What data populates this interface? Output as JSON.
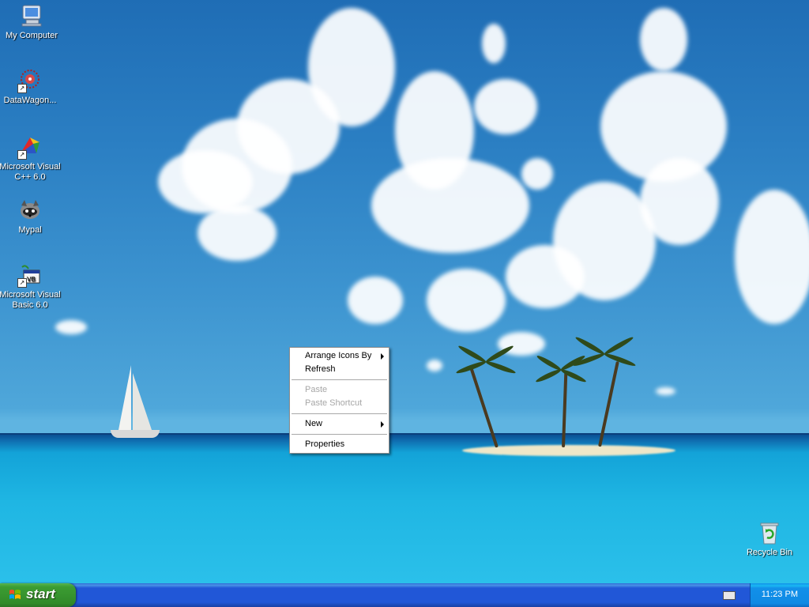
{
  "desktop": {
    "icons": [
      {
        "label": "My Computer",
        "icon": "my-computer-icon"
      },
      {
        "label": "DataWagon...",
        "icon": "datawagon-icon"
      },
      {
        "label": "Microsoft Visual C++ 6.0",
        "icon": "visual-cpp-icon"
      },
      {
        "label": "Mypal",
        "icon": "mypal-icon"
      },
      {
        "label": "Microsoft Visual Basic 6.0",
        "icon": "visual-basic-icon"
      },
      {
        "label": "Recycle Bin",
        "icon": "recycle-bin-icon"
      }
    ]
  },
  "context_menu": {
    "arrange_icons_by": "Arrange Icons By",
    "refresh": "Refresh",
    "paste": "Paste",
    "paste_shortcut": "Paste Shortcut",
    "new": "New",
    "properties": "Properties"
  },
  "taskbar": {
    "start_label": "start",
    "clock": "11:23 PM"
  },
  "colors": {
    "taskbar_blue": "#2157d7",
    "start_green": "#318a29",
    "tray_blue": "#0f8ae4"
  }
}
